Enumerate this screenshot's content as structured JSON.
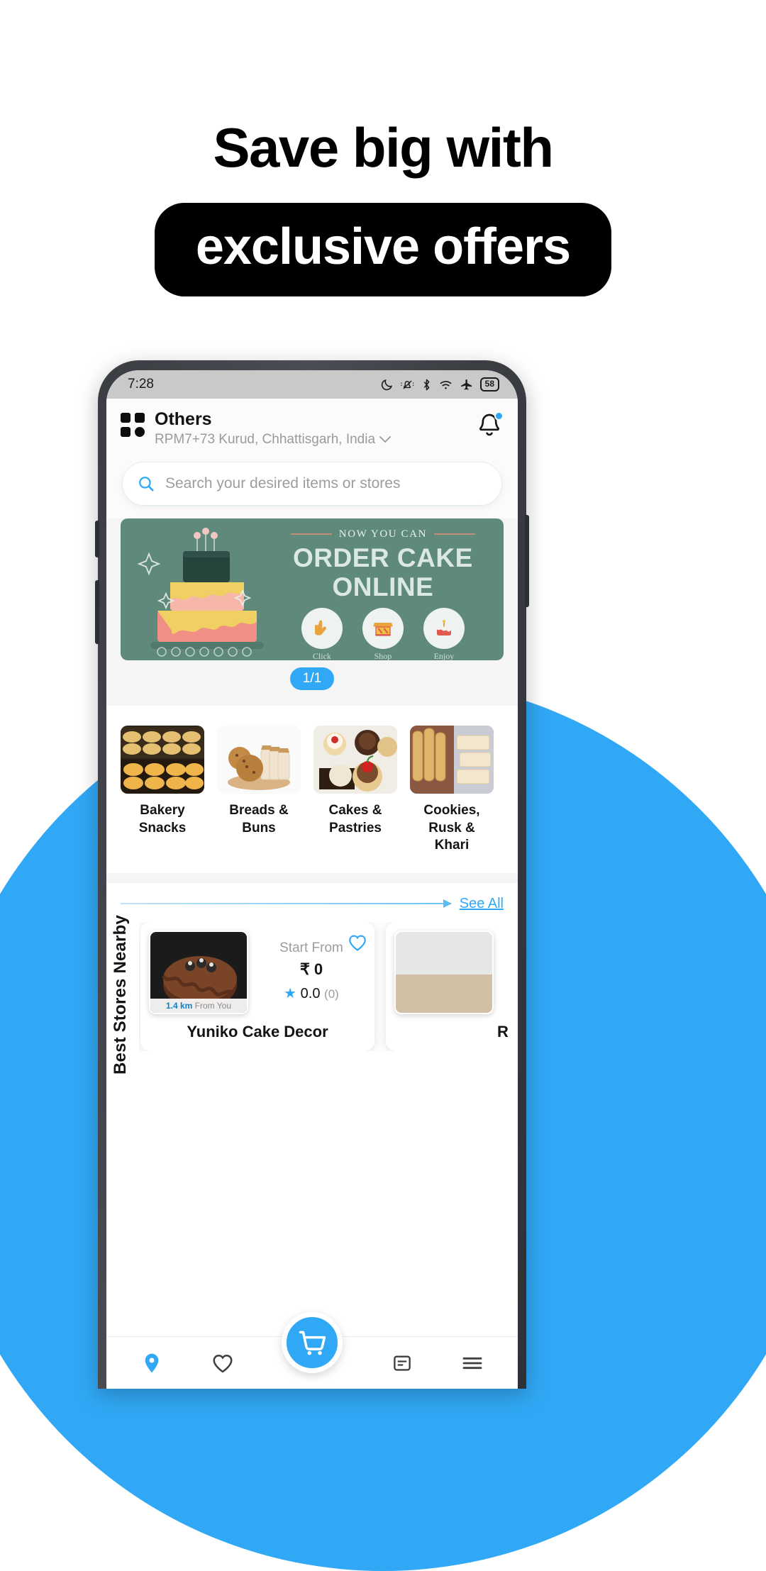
{
  "hero": {
    "line1": "Save big with",
    "badge": "exclusive offers"
  },
  "phone": {
    "status_bar": {
      "time": "7:28",
      "battery_percent": "58",
      "icons": [
        "moon-icon",
        "silent-bell-icon",
        "bluetooth-icon",
        "wifi-icon",
        "airplane-icon",
        "battery-icon"
      ]
    },
    "app_header": {
      "grid_icon": "grid-icon",
      "title": "Others",
      "location": "RPM7+73 Kurud, Chhattisgarh, India",
      "chevron": "⌄",
      "bell_icon": "bell-icon",
      "bell_has_badge": true
    },
    "search": {
      "placeholder": "Search your desired items or stores",
      "icon": "search-icon"
    },
    "banner": {
      "eyebrow": "NOW YOU CAN",
      "headline_line1": "ORDER CAKE",
      "headline_line2": "ONLINE",
      "steps": [
        {
          "label": "Click",
          "icon": "tap-hand-icon"
        },
        {
          "label": "Shop",
          "icon": "store-icon"
        },
        {
          "label": "Enjoy",
          "icon": "cake-icon"
        }
      ],
      "background_color": "#5f8a7b",
      "pager": "1/1",
      "pager_color": "#31a8f5"
    },
    "categories": [
      {
        "name": "Bakery Snacks",
        "image": "bakery-snacks-photo"
      },
      {
        "name": "Breads & Buns",
        "image": "breads-buns-photo"
      },
      {
        "name": "Cakes & Pastries",
        "image": "cakes-pastries-photo"
      },
      {
        "name": "Cookies, Rusk & Khari",
        "image": "cookies-rusk-khari-photo"
      }
    ],
    "stores_section": {
      "title": "Best Stores Nearby",
      "see_all": "See All",
      "cards": [
        {
          "name": "Yuniko Cake Decor",
          "distance": "1.4 km",
          "distance_suffix": "From You",
          "start_from_label": "Start From",
          "price": "₹ 0",
          "rating": "0.0",
          "rating_count": "(0)",
          "favorite_icon": "heart-icon",
          "image": "chocolate-cake-photo"
        },
        {
          "name": "R",
          "distance": "",
          "distance_suffix": "",
          "start_from_label": "",
          "price": "",
          "rating": "",
          "rating_count": "",
          "favorite_icon": "heart-icon",
          "image": "store-photo"
        }
      ]
    },
    "bottom_nav": {
      "items": [
        {
          "icon": "location-pin-icon",
          "active": true
        },
        {
          "icon": "heart-outline-icon",
          "active": false
        },
        {
          "icon": "cart-icon",
          "active": true
        },
        {
          "icon": "orders-icon",
          "active": false
        },
        {
          "icon": "menu-icon",
          "active": false
        }
      ]
    }
  },
  "colors": {
    "accent_blue": "#31A8F5",
    "banner_green": "#5f8a7b",
    "badge_black": "#000000"
  }
}
